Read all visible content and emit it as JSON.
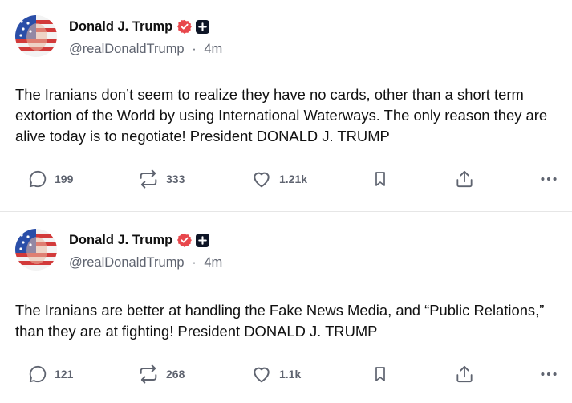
{
  "posts": [
    {
      "author": {
        "name": "Donald J. Trump",
        "handle": "@realDonaldTrump",
        "time": "4m"
      },
      "text": "The Iranians don’t seem to realize they have no cards, other than a short term extortion of the World by using International Waterways. The only reason they are alive today is to negotiate! President DONALD J. TRUMP",
      "stats": {
        "replies": "199",
        "retruths": "333",
        "likes": "1.21k"
      }
    },
    {
      "author": {
        "name": "Donald J. Trump",
        "handle": "@realDonaldTrump",
        "time": "4m"
      },
      "text": "The Iranians are better at handling the Fake News Media, and “Public Relations,” than they are at fighting! President DONALD J. TRUMP",
      "stats": {
        "replies": "121",
        "retruths": "268",
        "likes": "1.1k"
      }
    }
  ],
  "separator": "·",
  "icons": {
    "reply": "speech-bubble-icon",
    "retruth": "repost-arrows-icon",
    "like": "heart-icon",
    "save": "bookmark-icon",
    "share": "share-upload-icon",
    "more": "more-dots-icon",
    "verified": "verified-badge-icon",
    "plus": "plus-badge-icon"
  },
  "colors": {
    "verified_badge": "#e8474c",
    "icon_gray": "#5f6470",
    "text": "#111111",
    "muted": "#5f6470"
  }
}
